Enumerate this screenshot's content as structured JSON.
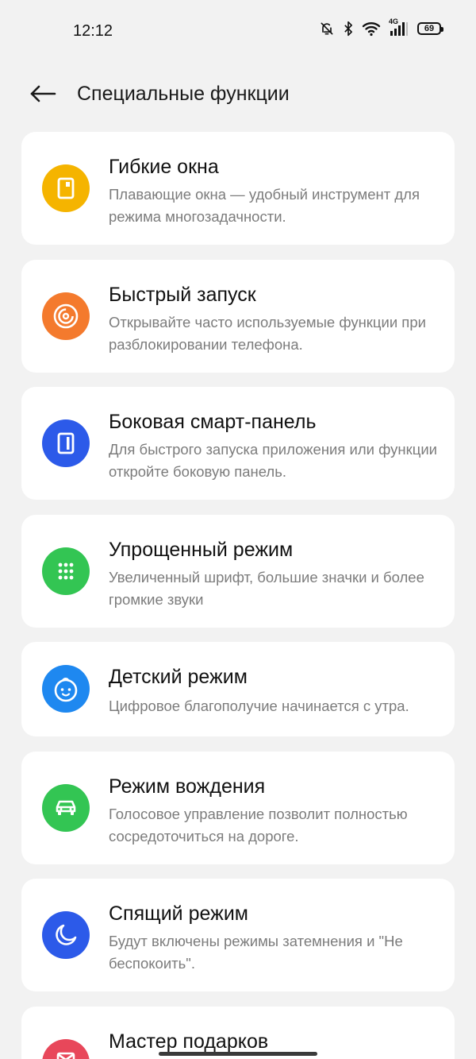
{
  "status_bar": {
    "time": "12:12",
    "battery": "69",
    "network": "4G",
    "icons": [
      "bell-off-icon",
      "bluetooth-icon",
      "wifi-icon",
      "signal-icon",
      "battery-icon"
    ]
  },
  "header": {
    "title": "Специальные функции",
    "back_icon": "arrow-left-icon"
  },
  "items": [
    {
      "title": "Гибкие окна",
      "desc": "Плавающие окна — удобный инструмент для режима многозадачности.",
      "icon": "floating-window-icon",
      "color": "#F5B400"
    },
    {
      "title": "Быстрый запуск",
      "desc": "Открывайте часто используемые функции при разблокировании телефона.",
      "icon": "fingerprint-ring-icon",
      "color": "#F47A2D"
    },
    {
      "title": "Боковая смарт-панель",
      "desc": "Для быстрого запуска приложения или функции откройте боковую панель.",
      "icon": "side-panel-icon",
      "color": "#2C5AE9"
    },
    {
      "title": "Упрощенный режим",
      "desc": "Увеличенный шрифт, большие значки и более громкие звуки",
      "icon": "grid-dots-icon",
      "color": "#33C553"
    },
    {
      "title": "Детский режим",
      "desc": "Цифровое благополучие начинается с утра.",
      "icon": "baby-face-icon",
      "color": "#1E88F0"
    },
    {
      "title": "Режим вождения",
      "desc": "Голосовое управление позволит полностью сосредоточиться на дороге.",
      "icon": "car-icon",
      "color": "#33C553"
    },
    {
      "title": "Спящий режим",
      "desc": "Будут включены режимы затемнения и \"Не беспокоить\".",
      "icon": "moon-icon",
      "color": "#2C5AE9"
    },
    {
      "title": "Мастер подарков",
      "desc": "",
      "icon": "gift-icon",
      "color": "#E8475A"
    }
  ]
}
